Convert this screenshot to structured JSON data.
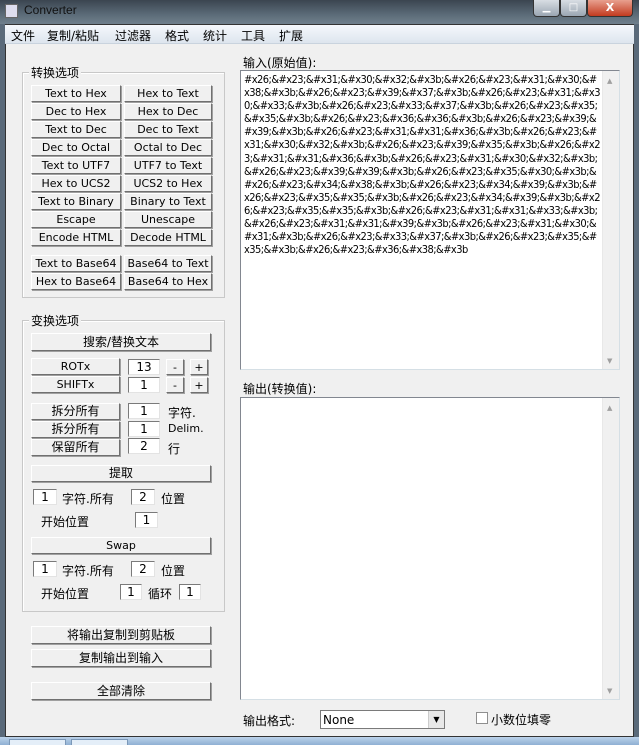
{
  "window": {
    "title": "Converter",
    "min": "▁",
    "max": "□",
    "close": "X"
  },
  "menu": [
    "文件",
    "复制/粘贴",
    "过滤器",
    "格式",
    "统计",
    "工具",
    "扩展"
  ],
  "convert": {
    "title": "转换选项",
    "buttons": [
      [
        "Text to Hex",
        "Hex to Text"
      ],
      [
        "Dec to Hex",
        "Hex to Dec"
      ],
      [
        "Text to Dec",
        "Dec to Text"
      ],
      [
        "Dec to Octal",
        "Octal to Dec"
      ],
      [
        "Text to UTF7",
        "UTF7 to Text"
      ],
      [
        "Hex to UCS2",
        "UCS2 to Hex"
      ],
      [
        "Text to Binary",
        "Binary to Text"
      ],
      [
        "Escape",
        "Unescape"
      ],
      [
        "Encode HTML",
        "Decode HTML"
      ],
      [
        "Text to Base64",
        "Base64 to Text"
      ],
      [
        "Hex to Base64",
        "Base64 to Hex"
      ]
    ]
  },
  "transform": {
    "title": "变换选项",
    "search": "搜索/替换文本",
    "rot": {
      "label": "ROTx",
      "value": "13"
    },
    "shift": {
      "label": "SHIFTx",
      "value": "1"
    },
    "minus": "-",
    "plus": "+",
    "split1": {
      "label": "拆分所有",
      "value": "1",
      "unit": "字符."
    },
    "split2": {
      "label": "拆分所有",
      "value": "1",
      "unit": "Delim."
    },
    "keep": {
      "label": "保留所有",
      "value": "2",
      "unit": "行"
    },
    "extract": {
      "label": "提取",
      "chars": "1",
      "chars_label": "字符.所有",
      "pos": "2",
      "pos_label": "位置",
      "start_label": "开始位置",
      "start": "1"
    },
    "swap": {
      "label": "Swap",
      "chars": "1",
      "chars_label": "字符.所有",
      "pos": "2",
      "pos_label": "位置",
      "start_label": "开始位置",
      "start": "1",
      "loop_label": "循环",
      "loop": "1"
    }
  },
  "actions": {
    "copy_clip": "将输出复制到剪贴板",
    "copy_input": "复制输出到输入",
    "clear": "全部清除"
  },
  "input": {
    "label": "输入(原始值):",
    "value": " #x26;&#x23;&#x31;&#x30;&#x32;&#x3b;&#x26;&#x23;&#x31;&#x30;&#x38;&#x3b;&#x26;&#x23;&#x39;&#x37;&#x3b;&#x26;&#x23;&#x31;&#x30;&#x33;&#x3b;&#x26;&#x23;&#x33;&#x37;&#x3b;&#x26;&#x23;&#x35;&#x35;&#x3b;&#x26;&#x23;&#x36;&#x36;&#x3b;&#x26;&#x23;&#x39;&#x39;&#x3b;&#x26;&#x23;&#x31;&#x31;&#x36;&#x3b;&#x26;&#x23;&#x31;&#x30;&#x32;&#x3b;&#x26;&#x23;&#x39;&#x35;&#x3b;&#x26;&#x23;&#x31;&#x31;&#x36;&#x3b;&#x26;&#x23;&#x31;&#x30;&#x32;&#x3b;&#x26;&#x23;&#x39;&#x39;&#x3b;&#x26;&#x23;&#x35;&#x30;&#x3b;&#x26;&#x23;&#x34;&#x38;&#x3b;&#x26;&#x23;&#x34;&#x39;&#x3b;&#x26;&#x23;&#x35;&#x35;&#x3b;&#x26;&#x23;&#x34;&#x39;&#x3b;&#x26;&#x23;&#x35;&#x35;&#x3b;&#x26;&#x23;&#x31;&#x31;&#x33;&#x3b;&#x26;&#x23;&#x31;&#x31;&#x39;&#x3b;&#x26;&#x23;&#x31;&#x30;&#x31;&#x3b;&#x26;&#x23;&#x33;&#x37;&#x3b;&#x26;&#x23;&#x35;&#x35;&#x3b;&#x26;&#x23;&#x36;&#x38;&#x3b"
  },
  "output": {
    "label": "输出(转换值):",
    "value": ""
  },
  "footer": {
    "format_label": "输出格式:",
    "format_value": "None",
    "pad_label": "小数位填零"
  }
}
